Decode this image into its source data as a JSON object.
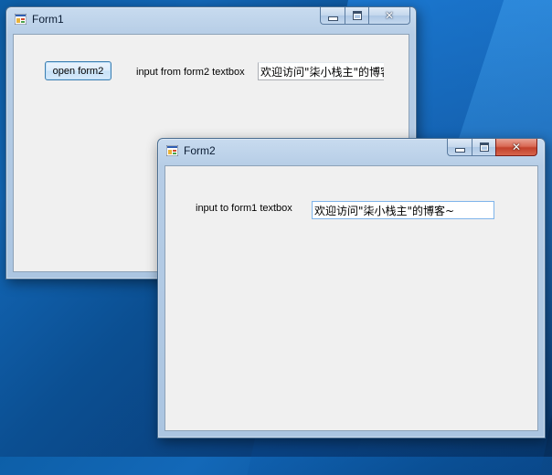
{
  "form1": {
    "title": "Form1",
    "open_button_label": "open form2",
    "input_label": "input from form2 textbox",
    "textbox_value": "欢迎访问\"柒小栈主\"的博客"
  },
  "form2": {
    "title": "Form2",
    "input_label": "input to form1 textbox",
    "textbox_value": "欢迎访问\"柒小栈主\"的博客~"
  },
  "icons": {
    "app": "winforms-app-icon",
    "minimize": "minimize-icon",
    "maximize": "maximize-icon",
    "close": "close-icon"
  },
  "colors": {
    "close_active": "#c2412b",
    "client_bg": "#f0f0f0",
    "button_border": "#3c7fb1"
  }
}
